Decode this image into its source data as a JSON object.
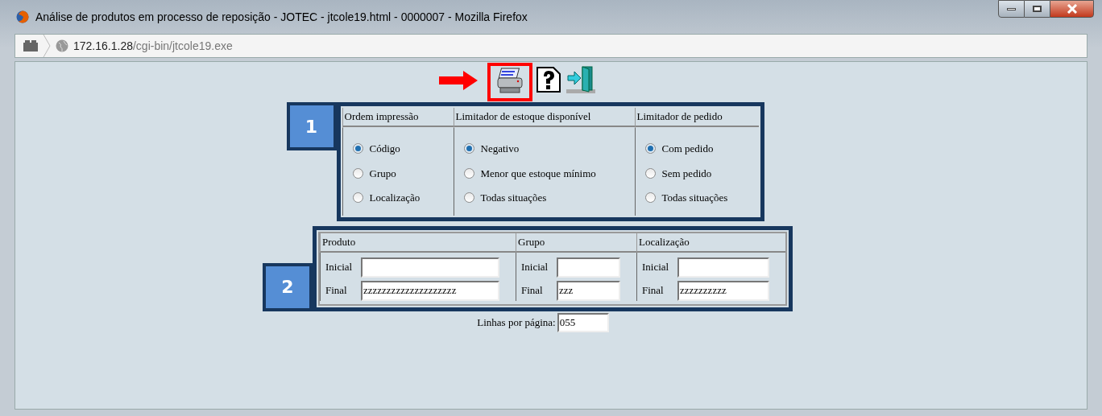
{
  "window": {
    "title": "Análise de produtos em processo de reposição - JOTEC - jtcole19.html - 0000007 - Mozilla Firefox"
  },
  "address_bar": {
    "host": "172.16.1.28",
    "path": "/cgi-bin/jtcole19.exe"
  },
  "toolbar": [
    {
      "kind": "print",
      "highlighted": true
    },
    {
      "kind": "help",
      "highlighted": false
    },
    {
      "kind": "exit",
      "highlighted": false
    }
  ],
  "callouts": [
    "1",
    "2"
  ],
  "options": [
    {
      "title": "Ordem impressão",
      "choices": [
        {
          "label": "Código",
          "selected": true
        },
        {
          "label": "Grupo",
          "selected": false
        },
        {
          "label": "Localização",
          "selected": false
        }
      ]
    },
    {
      "title": "Limitador de estoque disponível",
      "choices": [
        {
          "label": "Negativo",
          "selected": true
        },
        {
          "label": "Menor que estoque mínimo",
          "selected": false
        },
        {
          "label": "Todas situações",
          "selected": false
        }
      ]
    },
    {
      "title": "Limitador de pedido",
      "choices": [
        {
          "label": "Com pedido",
          "selected": true
        },
        {
          "label": "Sem pedido",
          "selected": false
        },
        {
          "label": "Todas situações",
          "selected": false
        }
      ]
    }
  ],
  "ranges": [
    {
      "title": "Produto",
      "fields": [
        {
          "label": "Inicial"
        },
        {
          "label": "Final",
          "value": "zzzzzzzzzzzzzzzzzzzz"
        }
      ]
    },
    {
      "title": "Grupo",
      "fields": [
        {
          "label": "Inicial"
        },
        {
          "label": "Final",
          "value": "zzz"
        }
      ]
    },
    {
      "title": "Localização",
      "fields": [
        {
          "label": "Inicial"
        },
        {
          "label": "Final",
          "value": "zzzzzzzzzz"
        }
      ]
    }
  ],
  "lines_per_page": {
    "label": "Linhas por página:",
    "value": "055"
  }
}
